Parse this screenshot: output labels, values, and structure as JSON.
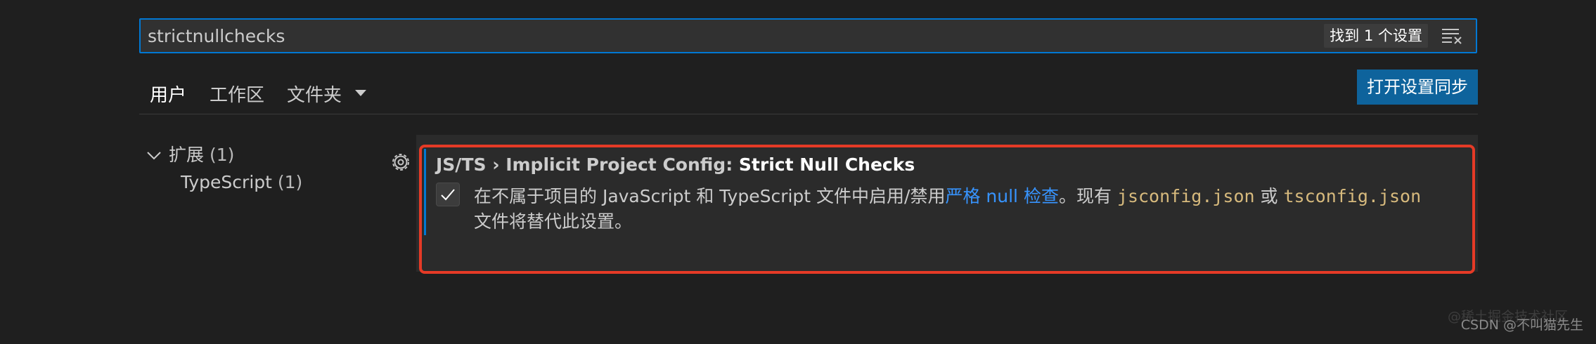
{
  "search": {
    "value": "strictnullchecks",
    "result_count": "找到 1 个设置",
    "filter_icon": "clear-filter-icon"
  },
  "tabs": [
    {
      "label": "用户",
      "active": true
    },
    {
      "label": "工作区",
      "active": false
    },
    {
      "label": "文件夹",
      "active": false
    }
  ],
  "sync_button_label": "打开设置同步",
  "toc": {
    "extensions": {
      "label": "扩展",
      "count": "(1)"
    },
    "typescript": {
      "label": "TypeScript",
      "count": "(1)"
    }
  },
  "setting": {
    "title_prefix": "JS/TS › Implicit Project Config: ",
    "title_name": "Strict Null Checks",
    "checked": true,
    "desc_part1": "在不属于项目的 JavaScript 和 TypeScript 文件中启用/禁用",
    "desc_link": "严格 null 检查",
    "desc_part2": "。现有 ",
    "desc_code1": "jsconfig.json",
    "desc_or": " 或 ",
    "desc_code2": "tsconfig.json",
    "desc_line2": "文件将替代此设置。"
  },
  "watermark": {
    "ghost": "@稀土掘金技术社区",
    "text": "CSDN @不叫猫先生"
  },
  "colors": {
    "accent": "#0078d4",
    "button": "#0e639c",
    "highlight_outline": "#e53a26",
    "link": "#3794ff",
    "code": "#d7ba7d"
  }
}
